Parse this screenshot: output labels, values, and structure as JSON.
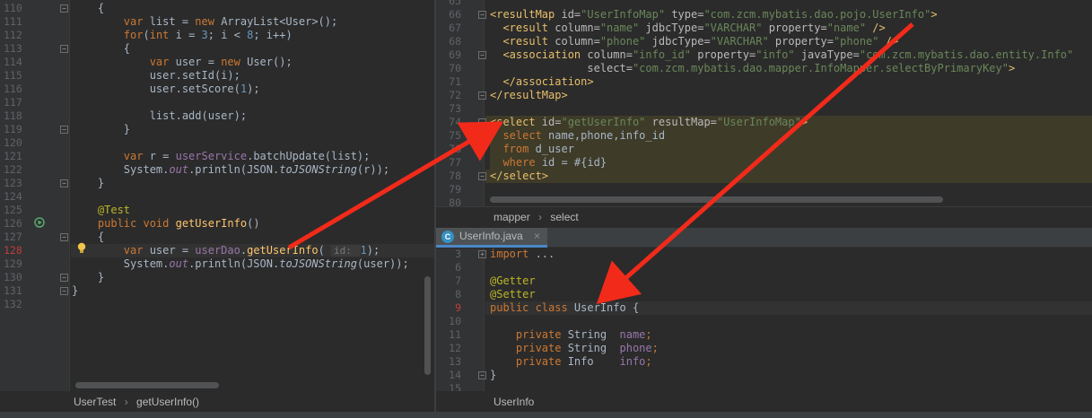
{
  "left_editor": {
    "lines": [
      {
        "n": "110",
        "indent": "    ",
        "parts": [
          [
            "plain",
            "{"
          ]
        ]
      },
      {
        "n": "111",
        "indent": "        ",
        "parts": [
          [
            "kw",
            "var "
          ],
          [
            "plain",
            "list = "
          ],
          [
            "kw",
            "new "
          ],
          [
            "plain",
            "ArrayList<User>();"
          ]
        ]
      },
      {
        "n": "112",
        "indent": "        ",
        "parts": [
          [
            "kw",
            "for"
          ],
          [
            "plain",
            "("
          ],
          [
            "kw",
            "int "
          ],
          [
            "plain",
            "i = "
          ],
          [
            "num",
            "3"
          ],
          [
            "plain",
            "; i < "
          ],
          [
            "num",
            "8"
          ],
          [
            "plain",
            "; i++)"
          ]
        ]
      },
      {
        "n": "113",
        "indent": "        ",
        "parts": [
          [
            "plain",
            "{"
          ]
        ]
      },
      {
        "n": "114",
        "indent": "            ",
        "parts": [
          [
            "kw",
            "var "
          ],
          [
            "plain",
            "user = "
          ],
          [
            "kw",
            "new "
          ],
          [
            "plain",
            "User();"
          ]
        ]
      },
      {
        "n": "115",
        "indent": "            ",
        "parts": [
          [
            "plain",
            "user.setId(i);"
          ]
        ]
      },
      {
        "n": "116",
        "indent": "            ",
        "parts": [
          [
            "plain",
            "user.setScore("
          ],
          [
            "num",
            "1"
          ],
          [
            "plain",
            ");"
          ]
        ]
      },
      {
        "n": "117",
        "indent": "",
        "parts": []
      },
      {
        "n": "118",
        "indent": "            ",
        "parts": [
          [
            "plain",
            "list.add(user);"
          ]
        ]
      },
      {
        "n": "119",
        "indent": "        ",
        "parts": [
          [
            "plain",
            "}"
          ]
        ]
      },
      {
        "n": "120",
        "indent": "",
        "parts": []
      },
      {
        "n": "121",
        "indent": "        ",
        "parts": [
          [
            "kw",
            "var "
          ],
          [
            "plain",
            "r = "
          ],
          [
            "field",
            "userService"
          ],
          [
            "plain",
            ".batchUpdate(list);"
          ]
        ]
      },
      {
        "n": "122",
        "indent": "        ",
        "parts": [
          [
            "plain",
            "System."
          ],
          [
            "field ital",
            "out"
          ],
          [
            "plain",
            ".println(JSON."
          ],
          [
            "ital",
            "toJSONString"
          ],
          [
            "plain",
            "(r));"
          ]
        ]
      },
      {
        "n": "123",
        "indent": "    ",
        "parts": [
          [
            "plain",
            "}"
          ]
        ]
      },
      {
        "n": "124",
        "indent": "",
        "parts": []
      },
      {
        "n": "125",
        "indent": "    ",
        "parts": [
          [
            "ann",
            "@Test"
          ]
        ]
      },
      {
        "n": "126",
        "indent": "    ",
        "parts": [
          [
            "kw",
            "public void "
          ],
          [
            "fn",
            "getUserInfo"
          ],
          [
            "plain",
            "()"
          ]
        ]
      },
      {
        "n": "127",
        "indent": "    ",
        "parts": [
          [
            "plain",
            "{"
          ]
        ]
      },
      {
        "n": "128",
        "indent": "        ",
        "parts": [
          [
            "kw",
            "var "
          ],
          [
            "plain",
            "user = "
          ],
          [
            "field",
            "userDao"
          ],
          [
            "plain",
            "."
          ],
          [
            "fn",
            "getUserInfo"
          ],
          [
            "plain",
            "( "
          ],
          [
            "hint",
            "id: "
          ],
          [
            "num",
            "1"
          ],
          [
            "plain",
            ");"
          ]
        ]
      },
      {
        "n": "129",
        "indent": "        ",
        "parts": [
          [
            "plain",
            "System."
          ],
          [
            "field ital",
            "out"
          ],
          [
            "plain",
            ".println(JSON."
          ],
          [
            "ital",
            "toJSONString"
          ],
          [
            "plain",
            "(user));"
          ]
        ]
      },
      {
        "n": "130",
        "indent": "    ",
        "parts": [
          [
            "plain",
            "}"
          ]
        ]
      },
      {
        "n": "131",
        "indent": "",
        "parts": [
          [
            "plain",
            "}"
          ]
        ]
      },
      {
        "n": "132",
        "indent": "",
        "parts": []
      }
    ],
    "breadcrumb": {
      "class_name": "UserTest",
      "method_name": "getUserInfo()"
    }
  },
  "xml_editor": {
    "lines": [
      {
        "n": "65",
        "parts": []
      },
      {
        "n": "66",
        "parts": [
          [
            "tag",
            "<resultMap "
          ],
          [
            "attr",
            "id="
          ],
          [
            "str",
            "\"UserInfoMap\" "
          ],
          [
            "attr",
            "type="
          ],
          [
            "str",
            "\"com.zcm.mybatis.dao.pojo.UserInfo\""
          ],
          [
            "tag",
            ">"
          ]
        ]
      },
      {
        "n": "67",
        "parts": [
          [
            "plain",
            "  "
          ],
          [
            "tag",
            "<result "
          ],
          [
            "attr",
            "column="
          ],
          [
            "str",
            "\"name\" "
          ],
          [
            "attr",
            "jdbcType="
          ],
          [
            "str",
            "\"VARCHAR\" "
          ],
          [
            "attr",
            "property="
          ],
          [
            "str",
            "\"name\" "
          ],
          [
            "tag",
            "/>"
          ]
        ]
      },
      {
        "n": "68",
        "parts": [
          [
            "plain",
            "  "
          ],
          [
            "tag",
            "<result "
          ],
          [
            "attr",
            "column="
          ],
          [
            "str",
            "\"phone\" "
          ],
          [
            "attr",
            "jdbcType="
          ],
          [
            "str",
            "\"VARCHAR\" "
          ],
          [
            "attr",
            "property="
          ],
          [
            "str",
            "\"phone\" "
          ],
          [
            "tag",
            "/>"
          ]
        ]
      },
      {
        "n": "69",
        "parts": [
          [
            "plain",
            "  "
          ],
          [
            "tag",
            "<association "
          ],
          [
            "attr",
            "column="
          ],
          [
            "str",
            "\"info_id\" "
          ],
          [
            "attr",
            "property="
          ],
          [
            "str",
            "\"info\" "
          ],
          [
            "attr",
            "javaType="
          ],
          [
            "str",
            "\"com.zcm.mybatis.dao.entity.Info\""
          ]
        ]
      },
      {
        "n": "70",
        "parts": [
          [
            "plain",
            "               "
          ],
          [
            "attr",
            "select="
          ],
          [
            "str",
            "\"com.zcm.mybatis.dao.mapper.InfoMapper.selectByPrimaryKey\""
          ],
          [
            "tag",
            ">"
          ]
        ]
      },
      {
        "n": "71",
        "parts": [
          [
            "plain",
            "  "
          ],
          [
            "tag",
            "</association>"
          ]
        ]
      },
      {
        "n": "72",
        "parts": [
          [
            "tag",
            "</resultMap>"
          ]
        ]
      },
      {
        "n": "73",
        "parts": []
      },
      {
        "n": "74",
        "parts": [
          [
            "tag",
            "<select "
          ],
          [
            "attr",
            "id="
          ],
          [
            "str",
            "\"getUserInfo\" "
          ],
          [
            "attr",
            "resultMap="
          ],
          [
            "str",
            "\"UserInfoMap\""
          ],
          [
            "tag",
            ">"
          ]
        ]
      },
      {
        "n": "75",
        "parts": [
          [
            "plain",
            "  "
          ],
          [
            "sqlkw",
            "select "
          ],
          [
            "plain",
            "name,phone,info_id"
          ]
        ]
      },
      {
        "n": "76",
        "parts": [
          [
            "plain",
            "  "
          ],
          [
            "sqlkw",
            "from "
          ],
          [
            "plain",
            "d_user"
          ]
        ]
      },
      {
        "n": "77",
        "parts": [
          [
            "plain",
            "  "
          ],
          [
            "sqlkw",
            "where "
          ],
          [
            "plain",
            "id = #{id}"
          ]
        ]
      },
      {
        "n": "78",
        "parts": [
          [
            "tag",
            "</select>"
          ]
        ]
      },
      {
        "n": "79",
        "parts": []
      },
      {
        "n": "80",
        "parts": []
      }
    ],
    "breadcrumb": {
      "root": "mapper",
      "child": "select"
    }
  },
  "java_editor": {
    "tab_label": "UserInfo.java",
    "tab_close": "×",
    "tab_icon_letter": "C",
    "lines": [
      {
        "n": "3",
        "parts": [
          [
            "kw",
            "import "
          ],
          [
            "plain",
            "..."
          ]
        ]
      },
      {
        "n": "6",
        "parts": []
      },
      {
        "n": "7",
        "parts": [
          [
            "ann",
            "@Getter"
          ]
        ]
      },
      {
        "n": "8",
        "parts": [
          [
            "ann",
            "@Setter"
          ]
        ]
      },
      {
        "n": "9",
        "parts": [
          [
            "kw",
            "public class "
          ],
          [
            "plain",
            "UserInfo {"
          ]
        ]
      },
      {
        "n": "10",
        "parts": []
      },
      {
        "n": "11",
        "parts": [
          [
            "plain",
            "    "
          ],
          [
            "kw",
            "private "
          ],
          [
            "plain",
            "String  "
          ],
          [
            "field",
            "name"
          ],
          [
            "kw",
            ";"
          ]
        ]
      },
      {
        "n": "12",
        "parts": [
          [
            "plain",
            "    "
          ],
          [
            "kw",
            "private "
          ],
          [
            "plain",
            "String  "
          ],
          [
            "field",
            "phone"
          ],
          [
            "kw",
            ";"
          ]
        ]
      },
      {
        "n": "13",
        "parts": [
          [
            "plain",
            "    "
          ],
          [
            "kw",
            "private "
          ],
          [
            "plain",
            "Info    "
          ],
          [
            "field",
            "info"
          ],
          [
            "kw",
            ";"
          ]
        ]
      },
      {
        "n": "14",
        "parts": [
          [
            "plain",
            "}"
          ]
        ]
      },
      {
        "n": "15",
        "parts": []
      }
    ],
    "breadcrumb": {
      "class_name": "UserInfo"
    }
  },
  "colors": {
    "arrow": "#f22a1a",
    "background": "#2b2b2b",
    "keyword": "#cc7832",
    "string": "#6a8759"
  }
}
